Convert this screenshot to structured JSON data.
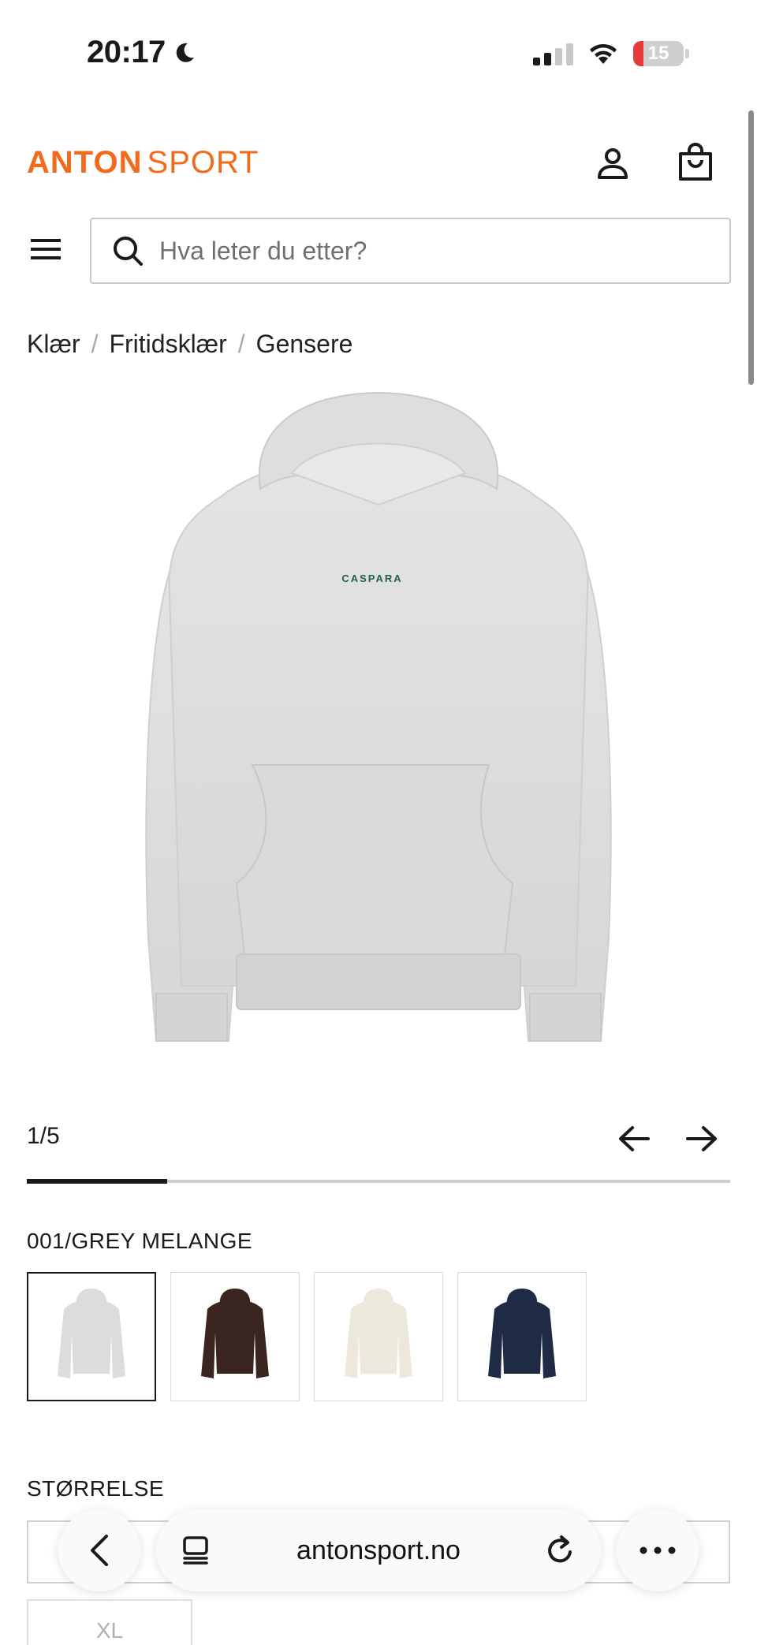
{
  "status_bar": {
    "time": "20:17",
    "battery": "15"
  },
  "header": {
    "logo_primary": "ANTON",
    "logo_secondary": "SPORT",
    "search_placeholder": "Hva leter du etter?"
  },
  "breadcrumb": [
    "Klær",
    "Fritidsklær",
    "Gensere"
  ],
  "product_image": {
    "print_text": "CASPARA"
  },
  "gallery": {
    "counter": "1/5",
    "progress": 0.2
  },
  "colors": {
    "selected_label": "001/GREY MELANGE",
    "swatches": [
      {
        "color": "#dcdcdc",
        "selected": true
      },
      {
        "color": "#3b2520",
        "selected": false
      },
      {
        "color": "#ece8dc",
        "selected": false
      },
      {
        "color": "#1f2a44",
        "selected": false
      }
    ]
  },
  "size": {
    "label": "STØRRELSE",
    "options": [
      "XL"
    ]
  },
  "browser": {
    "url": "antonsport.no"
  },
  "theme": {
    "brand": "#f26b1d",
    "text": "#1a1a1a"
  }
}
